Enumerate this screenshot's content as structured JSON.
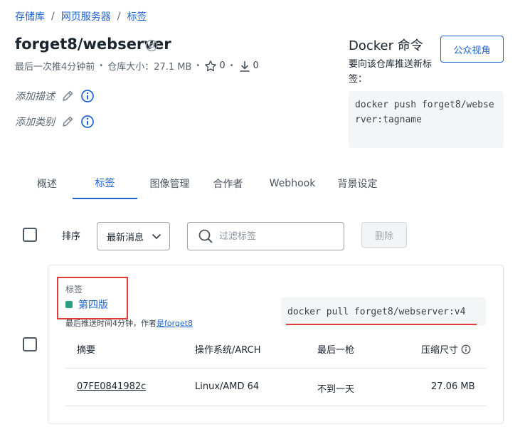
{
  "breadcrumb": {
    "items": [
      "存储库",
      "网页服务器",
      "标签"
    ],
    "separator": "/"
  },
  "repo": {
    "title": "forget8/webserver",
    "last_pushed": "最后一次推4分钟前",
    "size": "仓库大小：27.1 MB",
    "stars": "0",
    "downloads": "0",
    "add_description": "添加描述",
    "add_category": "添加类别"
  },
  "docker": {
    "title": "Docker 命令",
    "description": "要向该仓库推送新标签：",
    "command": "docker push forget8/webserver:tagname",
    "public_view_button": "公众视角"
  },
  "tabs": [
    {
      "label": "概述",
      "active": false
    },
    {
      "label": "标签",
      "active": true
    },
    {
      "label": "图像管理",
      "active": false
    },
    {
      "label": "合作者",
      "active": false
    },
    {
      "label": "Webhook",
      "active": false
    },
    {
      "label": "背景设定",
      "active": false
    }
  ],
  "toolbar": {
    "sort_label": "排序",
    "sort_value": "最新消息",
    "filter_placeholder": "过滤标签",
    "delete_label": "删除"
  },
  "tag_card": {
    "tag_label": "标签",
    "tag_name": "第四版",
    "pushed_text": "最后推送时间4分钟，作者",
    "pushed_by": "是forget8",
    "pull_command": "docker pull forget8/webserver:v4",
    "columns": [
      "摘要",
      "操作系统/ARCH",
      "最后一枪",
      "压缩尺寸"
    ],
    "rows": [
      {
        "digest": "07FE0841982c",
        "os_arch": "Linux/AMD 64",
        "last_pull": "不到一天",
        "size": "27.06 MB"
      }
    ]
  },
  "colors": {
    "accent": "#1d63d2",
    "highlight": "#e03a3a",
    "tag_status": "#2a9d82"
  }
}
